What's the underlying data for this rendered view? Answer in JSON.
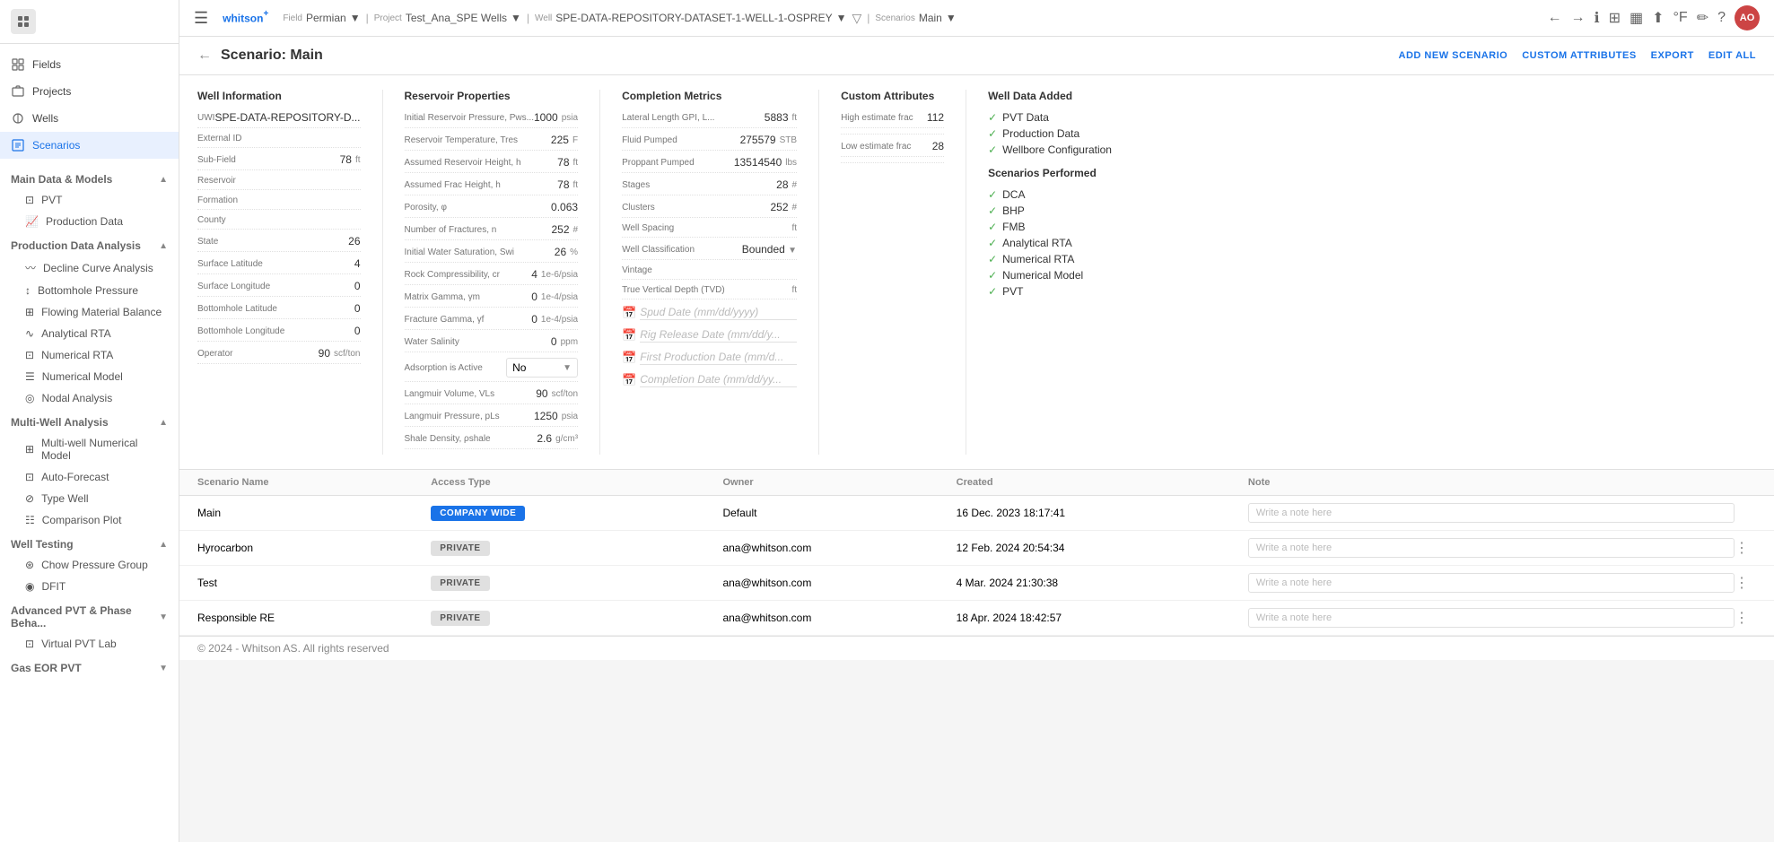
{
  "brand": {
    "name": "whitson",
    "plus": "+"
  },
  "topbar": {
    "breadcrumbs": [
      {
        "label": "Field",
        "value": "Permian",
        "dropdown": true
      },
      {
        "label": "Project",
        "value": "Test_Ana_SPE Wells",
        "dropdown": true
      },
      {
        "label": "Well",
        "value": "SPE-DATA-REPOSITORY-DATASET-1-WELL-1-OSPREY",
        "dropdown": true
      },
      {
        "label": "Scenarios",
        "value": "Main",
        "dropdown": true
      }
    ]
  },
  "scenario": {
    "title": "Scenario: Main",
    "actions": [
      "ADD NEW SCENARIO",
      "CUSTOM ATTRIBUTES",
      "EXPORT",
      "EDIT ALL"
    ]
  },
  "well_information": {
    "title": "Well Information",
    "uwi": "SPE-DATA-REPOSITORY-D...",
    "external_id": "",
    "sub_field": "78",
    "reservoir": "",
    "formation": "",
    "county": "",
    "state": "26",
    "surface_latitude": "4",
    "surface_longitude": "0",
    "bottomhole_latitude": "0",
    "bottomhole_longitude": "0",
    "operator": "90",
    "uwi_label": "UWI",
    "external_id_label": "External ID",
    "sub_field_label": "Sub-Field",
    "reservoir_label": "Reservoir",
    "formation_label": "Formation",
    "county_label": "County",
    "state_label": "State",
    "surface_lat_label": "Surface Latitude",
    "surface_lon_label": "Surface Longitude",
    "bh_lat_label": "Bottomhole Latitude",
    "bh_lon_label": "Bottomhole Longitude",
    "operator_label": "Operator"
  },
  "reservoir_properties": {
    "title": "Reservoir Properties",
    "fields": [
      {
        "label": "Initial Reservoir Pressure, Pws...",
        "value": "1000",
        "unit": "psia"
      },
      {
        "label": "Reservoir Temperature, Tres",
        "value": "225",
        "unit": "F"
      },
      {
        "label": "Assumed Reservoir Height, h",
        "value": "78",
        "unit": "ft"
      },
      {
        "label": "Assumed Frac Height, h",
        "value": "78",
        "unit": "ft"
      },
      {
        "label": "Porosity, φ",
        "value": "0.063",
        "unit": ""
      },
      {
        "label": "Number of Fractures, n",
        "value": "252",
        "unit": "#"
      },
      {
        "label": "Initial Water Saturation, Swi",
        "value": "26",
        "unit": "%"
      },
      {
        "label": "Rock Compressibility, cr",
        "value": "4",
        "unit": "1e-6/psia"
      },
      {
        "label": "Matrix Gamma, γm",
        "value": "0",
        "unit": "1e-4/psia"
      },
      {
        "label": "Fracture Gamma, γf",
        "value": "0",
        "unit": "1e-4/psia"
      },
      {
        "label": "Water Salinity",
        "value": "0",
        "unit": "ppm"
      },
      {
        "label": "Adsorption is Active",
        "value": "No",
        "unit": "",
        "type": "select"
      },
      {
        "label": "Langmuir Volume, VLs",
        "value": "90",
        "unit": "scf/ton"
      },
      {
        "label": "Langmuir Pressure, pLs",
        "value": "1250",
        "unit": "psia"
      },
      {
        "label": "Shale Density, ρshale",
        "value": "2.6",
        "unit": "g/cm³"
      }
    ]
  },
  "completion_metrics": {
    "title": "Completion Metrics",
    "fields": [
      {
        "label": "Lateral Length GPI, L...",
        "value": "5883",
        "unit": "ft"
      },
      {
        "label": "Fluid Pumped",
        "value": "275579",
        "unit": "STB"
      },
      {
        "label": "Proppant Pumped",
        "value": "13514540",
        "unit": "lbs"
      },
      {
        "label": "Stages",
        "value": "28",
        "unit": "#"
      },
      {
        "label": "Clusters",
        "value": "252",
        "unit": "#"
      }
    ],
    "well_spacing_label": "Well Spacing",
    "well_spacing_value": "",
    "well_spacing_unit": "ft",
    "well_classification_label": "Well Classification",
    "well_classification_value": "Bounded",
    "vintage_label": "Vintage",
    "vintage_value": "",
    "tvd_label": "True Vertical Depth (TVD)",
    "tvd_value": "",
    "tvd_unit": "ft",
    "spud_date_label": "Spud Date (mm/dd/yyyy)",
    "rig_release_label": "Rig Release Date (mm/dd/y...",
    "first_prod_label": "First Production Date (mm/d...",
    "completion_date_label": "Completion Date (mm/dd/yy..."
  },
  "custom_attributes": {
    "title": "Custom Attributes",
    "high_estimate_label": "High estimate frac",
    "high_estimate_value": "112",
    "low_estimate_label": "Low estimate frac",
    "low_estimate_value": "28"
  },
  "well_data_added": {
    "title": "Well Data Added",
    "items": [
      "PVT Data",
      "Production Data",
      "Wellbore Configuration"
    ]
  },
  "scenarios_performed": {
    "title": "Scenarios Performed",
    "items": [
      "DCA",
      "BHP",
      "FMB",
      "Analytical RTA",
      "Numerical RTA",
      "Numerical Model",
      "PVT"
    ]
  },
  "scenarios_table": {
    "columns": [
      "Scenario Name",
      "Access Type",
      "Owner",
      "Created",
      "Note"
    ],
    "rows": [
      {
        "name": "Main",
        "access": "COMPANY WIDE",
        "access_type": "company",
        "owner": "Default",
        "created": "16 Dec. 2023 18:17:41",
        "note_placeholder": "Write a note here",
        "has_menu": false
      },
      {
        "name": "Hyrocarbon",
        "access": "PRIVATE",
        "access_type": "private",
        "owner": "ana@whitson.com",
        "created": "12 Feb. 2024 20:54:34",
        "note_placeholder": "Write a note here",
        "has_menu": true
      },
      {
        "name": "Test",
        "access": "PRIVATE",
        "access_type": "private",
        "owner": "ana@whitson.com",
        "created": "4 Mar. 2024 21:30:38",
        "note_placeholder": "Write a note here",
        "has_menu": true
      },
      {
        "name": "Responsible RE",
        "access": "PRIVATE",
        "access_type": "private",
        "owner": "ana@whitson.com",
        "created": "18 Apr. 2024 18:42:57",
        "note_placeholder": "Write a note here",
        "has_menu": true
      }
    ]
  },
  "sidebar": {
    "nav_items": [
      {
        "label": "Fields",
        "icon": "grid"
      },
      {
        "label": "Projects",
        "icon": "folder"
      },
      {
        "label": "Wells",
        "icon": "well"
      },
      {
        "label": "Scenarios",
        "icon": "scenario",
        "active": true
      }
    ],
    "sections": [
      {
        "label": "Main Data & Models",
        "items": [
          {
            "label": "PVT",
            "icon": "pvt"
          },
          {
            "label": "Production Data",
            "icon": "prod"
          }
        ]
      },
      {
        "label": "Production Data Analysis",
        "items": [
          {
            "label": "Decline Curve Analysis",
            "icon": "dca"
          },
          {
            "label": "Bottomhole Pressure",
            "icon": "bhp"
          },
          {
            "label": "Flowing Material Balance",
            "icon": "fmb"
          },
          {
            "label": "Analytical RTA",
            "icon": "rta"
          },
          {
            "label": "Numerical RTA",
            "icon": "nrta"
          },
          {
            "label": "Numerical Model",
            "icon": "nm"
          },
          {
            "label": "Nodal Analysis",
            "icon": "nodal"
          }
        ]
      },
      {
        "label": "Multi-Well Analysis",
        "items": [
          {
            "label": "Multi-well Numerical Model",
            "icon": "mwnm"
          },
          {
            "label": "Auto-Forecast",
            "icon": "af"
          },
          {
            "label": "Type Well",
            "icon": "tw"
          },
          {
            "label": "Comparison Plot",
            "icon": "cp"
          }
        ]
      },
      {
        "label": "Well Testing",
        "items": [
          {
            "label": "Chow Pressure Group",
            "icon": "cpg"
          },
          {
            "label": "DFIT",
            "icon": "dfit"
          }
        ]
      },
      {
        "label": "Advanced PVT & Phase Beha...",
        "items": [
          {
            "label": "Virtual PVT Lab",
            "icon": "vpvt"
          }
        ]
      },
      {
        "label": "Gas EOR PVT",
        "items": []
      }
    ]
  },
  "footer": {
    "text": "© 2024 - Whitson AS. All rights reserved"
  }
}
